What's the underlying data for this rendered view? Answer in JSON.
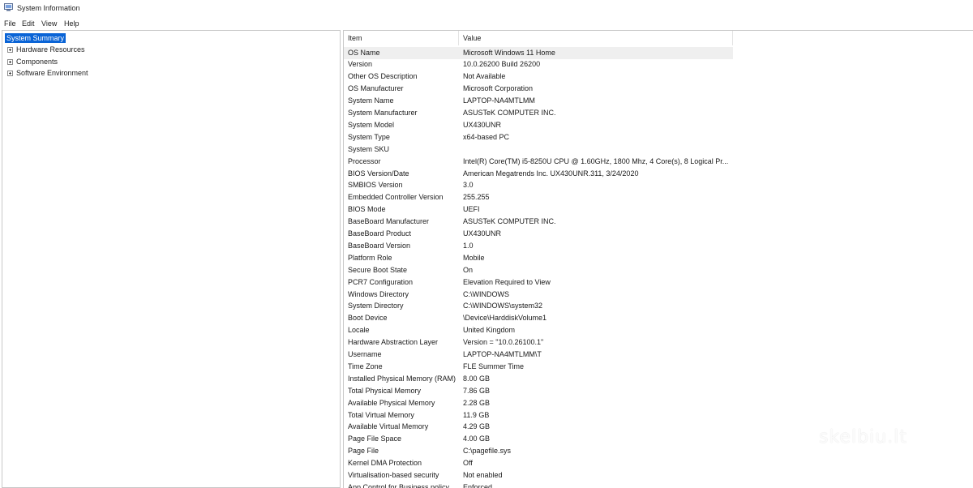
{
  "window": {
    "title": "System Information"
  },
  "menu": [
    "File",
    "Edit",
    "View",
    "Help"
  ],
  "tree": {
    "root": "System Summary",
    "children": [
      "Hardware Resources",
      "Components",
      "Software Environment"
    ]
  },
  "table": {
    "headers": {
      "item": "Item",
      "value": "Value"
    },
    "rows": [
      {
        "item": "OS Name",
        "value": "Microsoft Windows 11 Home"
      },
      {
        "item": "Version",
        "value": "10.0.26200 Build 26200"
      },
      {
        "item": "Other OS Description",
        "value": "Not Available"
      },
      {
        "item": "OS Manufacturer",
        "value": "Microsoft Corporation"
      },
      {
        "item": "System Name",
        "value": "LAPTOP-NA4MTLMM"
      },
      {
        "item": "System Manufacturer",
        "value": "ASUSTeK COMPUTER INC."
      },
      {
        "item": "System Model",
        "value": "UX430UNR"
      },
      {
        "item": "System Type",
        "value": "x64-based PC"
      },
      {
        "item": "System SKU",
        "value": ""
      },
      {
        "item": "Processor",
        "value": "Intel(R) Core(TM) i5-8250U CPU @ 1.60GHz, 1800 Mhz, 4 Core(s), 8 Logical Pr..."
      },
      {
        "item": "BIOS Version/Date",
        "value": "American Megatrends Inc. UX430UNR.311, 3/24/2020"
      },
      {
        "item": "SMBIOS Version",
        "value": "3.0"
      },
      {
        "item": "Embedded Controller Version",
        "value": "255.255"
      },
      {
        "item": "BIOS Mode",
        "value": "UEFI"
      },
      {
        "item": "BaseBoard Manufacturer",
        "value": "ASUSTeK COMPUTER INC."
      },
      {
        "item": "BaseBoard Product",
        "value": "UX430UNR"
      },
      {
        "item": "BaseBoard Version",
        "value": "1.0"
      },
      {
        "item": "Platform Role",
        "value": "Mobile"
      },
      {
        "item": "Secure Boot State",
        "value": "On"
      },
      {
        "item": "PCR7 Configuration",
        "value": "Elevation Required to View"
      },
      {
        "item": "Windows Directory",
        "value": "C:\\WINDOWS"
      },
      {
        "item": "System Directory",
        "value": "C:\\WINDOWS\\system32"
      },
      {
        "item": "Boot Device",
        "value": "\\Device\\HarddiskVolume1"
      },
      {
        "item": "Locale",
        "value": "United Kingdom"
      },
      {
        "item": "Hardware Abstraction Layer",
        "value": "Version = \"10.0.26100.1\""
      },
      {
        "item": "Username",
        "value": "LAPTOP-NA4MTLMM\\T"
      },
      {
        "item": "Time Zone",
        "value": "FLE Summer Time"
      },
      {
        "item": "Installed Physical Memory (RAM)",
        "value": "8.00 GB"
      },
      {
        "item": "Total Physical Memory",
        "value": "7.86 GB"
      },
      {
        "item": "Available Physical Memory",
        "value": "2.28 GB"
      },
      {
        "item": "Total Virtual Memory",
        "value": "11.9 GB"
      },
      {
        "item": "Available Virtual Memory",
        "value": "4.29 GB"
      },
      {
        "item": "Page File Space",
        "value": "4.00 GB"
      },
      {
        "item": "Page File",
        "value": "C:\\pagefile.sys"
      },
      {
        "item": "Kernel DMA Protection",
        "value": "Off"
      },
      {
        "item": "Virtualisation-based security",
        "value": "Not enabled"
      },
      {
        "item": "App Control for Business policy",
        "value": "Enforced"
      }
    ]
  },
  "watermark": "skelbiu.lt",
  "colors": {
    "selection": "#0a64d6",
    "selected_row": "#efefef"
  }
}
